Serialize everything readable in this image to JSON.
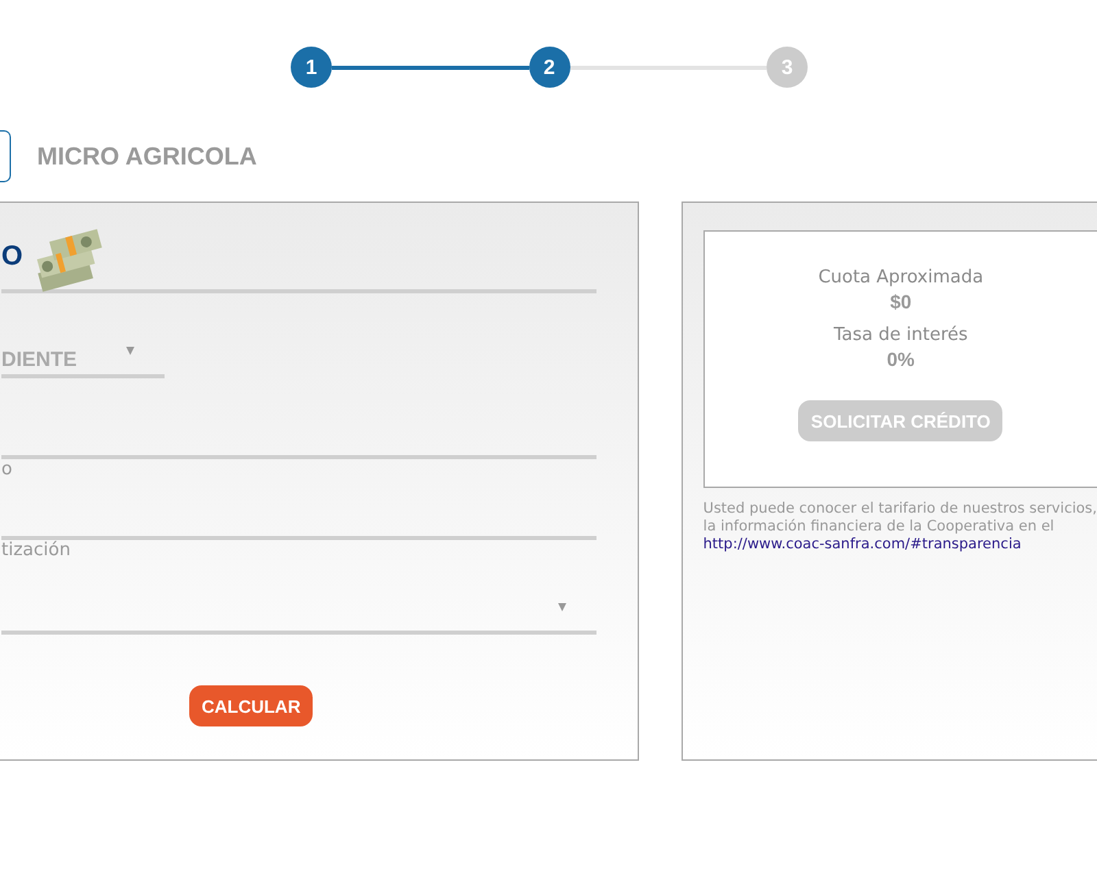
{
  "steps": [
    {
      "label": "1",
      "reached": true
    },
    {
      "label": "2",
      "reached": true
    },
    {
      "label": "3",
      "reached": false
    }
  ],
  "product": {
    "title": "MICRO AGRICOLA"
  },
  "form": {
    "heading": "O",
    "fields": [
      {
        "kind": "select",
        "value": "DIENTE",
        "short": true
      },
      {
        "kind": "input",
        "short": false
      },
      {
        "kind": "input",
        "label": "o",
        "short": false
      },
      {
        "kind": "select",
        "label": "tización",
        "short": false
      }
    ],
    "button": "CALCULAR"
  },
  "result": {
    "items": [
      {
        "label": "Cuota Aproximada",
        "value": "$0"
      },
      {
        "label": "Tasa de interés",
        "value": "0%"
      }
    ],
    "button": {
      "label": "SOLICITAR CRÉDITO",
      "disabled": true
    }
  },
  "notice": {
    "lines": [
      "Usted puede conocer el tarifario de nuestros servicios,",
      "la información financiera de la Cooperativa en el"
    ],
    "link": "http://www.coac-sanfra.com/#transparencia"
  }
}
